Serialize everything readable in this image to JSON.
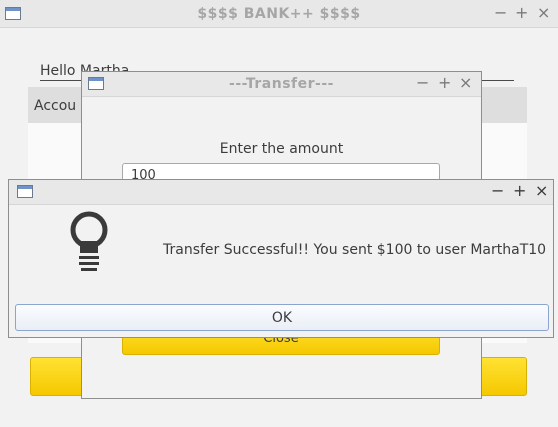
{
  "main_window": {
    "title": "$$$$ BANK++ $$$$",
    "greeting": "Hello Martha",
    "section_label": "Accou",
    "controls": {
      "minimize": "−",
      "maximize": "+",
      "close": "×"
    }
  },
  "transfer_dialog": {
    "title": "---Transfer---",
    "prompt": "Enter the amount",
    "amount_value": "100",
    "close_button": "Close",
    "controls": {
      "minimize": "−",
      "maximize": "+",
      "close": "×"
    }
  },
  "message_dialog": {
    "message": "Transfer Successful!! You sent $100 to user MarthaT10",
    "ok_button": "OK",
    "icon": "lightbulb-icon",
    "controls": {
      "minimize": "−",
      "maximize": "+",
      "close": "×"
    }
  },
  "colors": {
    "accent_yellow": "#ffd400",
    "window_bg": "#f2f2f2"
  }
}
